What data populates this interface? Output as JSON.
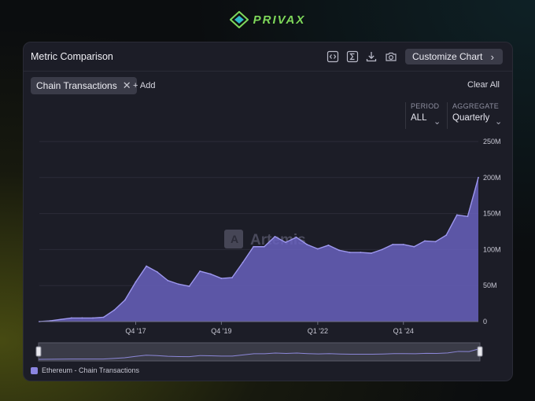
{
  "brand": {
    "name": "PRIVAX"
  },
  "header": {
    "title": "Metric Comparison",
    "tools": [
      "embed-icon",
      "sigma-icon",
      "download-icon",
      "camera-icon"
    ],
    "customize_label": "Customize Chart"
  },
  "filters": {
    "chip_label": "Chain Transactions",
    "add_label": "+ Add",
    "clear_label": "Clear All",
    "period": {
      "label": "PERIOD",
      "value": "ALL"
    },
    "aggregate": {
      "label": "AGGREGATE",
      "value": "Quarterly"
    }
  },
  "watermark": "Artemis",
  "legend": {
    "label": "Ethereum - Chain Transactions"
  },
  "colors": {
    "area": "#6a63c2",
    "line": "#9d97ee",
    "card": "#1c1d27"
  },
  "chart_data": {
    "type": "area",
    "x": [
      "Q3 '15",
      "Q4 '15",
      "Q1 '16",
      "Q2 '16",
      "Q3 '16",
      "Q4 '16",
      "Q1 '17",
      "Q2 '17",
      "Q3 '17",
      "Q4 '17",
      "Q1 '18",
      "Q2 '18",
      "Q3 '18",
      "Q4 '18",
      "Q1 '19",
      "Q2 '19",
      "Q3 '19",
      "Q4 '19",
      "Q1 '20",
      "Q2 '20",
      "Q3 '20",
      "Q4 '20",
      "Q1 '21",
      "Q2 '21",
      "Q3 '21",
      "Q4 '21",
      "Q1 '22",
      "Q2 '22",
      "Q3 '22",
      "Q4 '22",
      "Q1 '23",
      "Q2 '23",
      "Q3 '23",
      "Q4 '23",
      "Q1 '24",
      "Q2 '24",
      "Q3 '24",
      "Q4 '24",
      "Q1 '25",
      "Q2 '25",
      "Q3 '25",
      "Q4 '25",
      "Q1 '26"
    ],
    "series": [
      {
        "name": "Ethereum - Chain Transactions",
        "values": [
          0,
          1,
          3,
          5,
          5,
          5,
          6,
          16,
          30,
          55,
          77,
          69,
          57,
          52,
          49,
          70,
          66,
          60,
          61,
          82,
          104,
          104,
          118,
          110,
          117,
          107,
          101,
          106,
          99,
          96,
          96,
          95,
          100,
          107,
          107,
          104,
          112,
          111,
          120,
          148,
          146,
          200
        ]
      }
    ],
    "xticks": [
      "Q4 '17",
      "Q4 '19",
      "Q1 '22",
      "Q1 '24"
    ],
    "yticks": [
      "250M",
      "200M",
      "150M",
      "100M",
      "50M",
      "0"
    ],
    "ylim": [
      0,
      250
    ],
    "ylabel": "",
    "grid": true
  }
}
